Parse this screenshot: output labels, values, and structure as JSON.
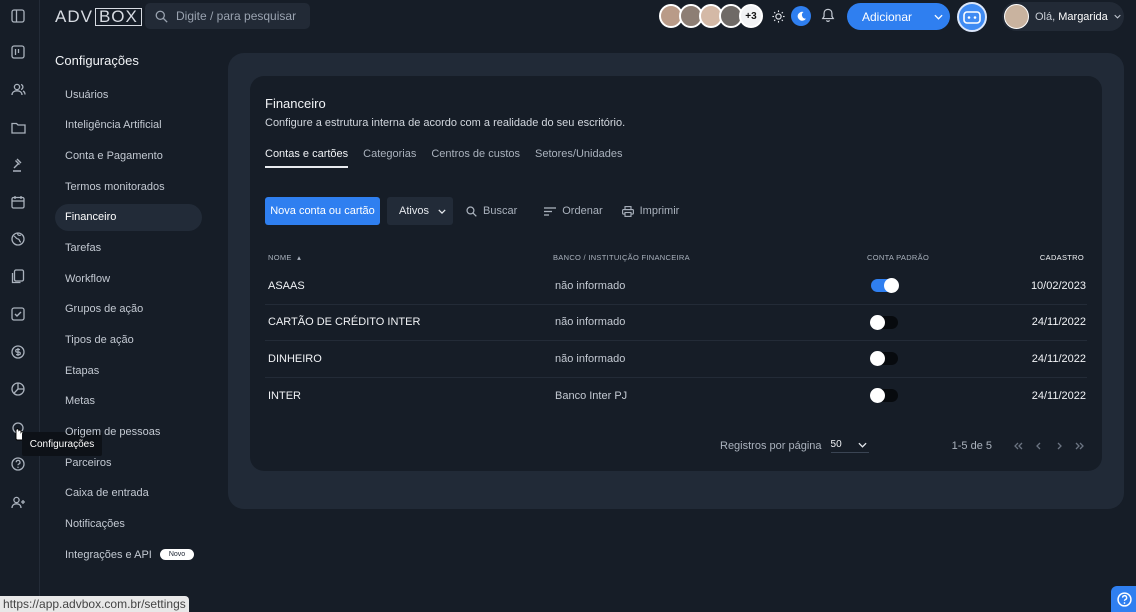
{
  "topbar": {
    "logo_adv": "ADV",
    "logo_box": "BOX",
    "search_placeholder": "Digite / para pesquisar",
    "avatars_more": "+3",
    "add_button": "Adicionar",
    "greeting": "Olá,",
    "user_name": "Margarida"
  },
  "rail": {
    "icons": [
      "layout-icon",
      "kanban-icon",
      "users-icon",
      "folder-icon",
      "gavel-icon",
      "calendar-icon",
      "globe-icon",
      "documents-icon",
      "checklist-icon",
      "dollar-icon",
      "chart-pie-icon",
      "gear-icon",
      "help-circle-icon",
      "user-plus-icon"
    ],
    "tooltip": "Configurações"
  },
  "sidebar": {
    "title": "Configurações",
    "items": [
      {
        "label": "Usuários"
      },
      {
        "label": "Inteligência Artificial"
      },
      {
        "label": "Conta e Pagamento"
      },
      {
        "label": "Termos monitorados"
      },
      {
        "label": "Financeiro",
        "active": true
      },
      {
        "label": "Tarefas"
      },
      {
        "label": "Workflow"
      },
      {
        "label": "Grupos de ação"
      },
      {
        "label": "Tipos de ação"
      },
      {
        "label": "Etapas"
      },
      {
        "label": "Metas"
      },
      {
        "label": "Origem de pessoas"
      },
      {
        "label": "Parceiros"
      },
      {
        "label": "Caixa de entrada"
      },
      {
        "label": "Notificações"
      },
      {
        "label": "Integrações e API",
        "badge": "Novo"
      }
    ]
  },
  "main": {
    "title": "Financeiro",
    "subtitle": "Configure a estrutura interna de acordo com a realidade do seu escritório.",
    "tabs": [
      {
        "label": "Contas e cartões",
        "active": true
      },
      {
        "label": "Categorias"
      },
      {
        "label": "Centros de custos"
      },
      {
        "label": "Setores/Unidades"
      }
    ],
    "toolbar": {
      "new_button": "Nova conta ou cartão",
      "filter_value": "Ativos",
      "search": "Buscar",
      "order": "Ordenar",
      "print": "Imprimir"
    },
    "table": {
      "columns": [
        "NOME",
        "BANCO / INSTITUIÇÃO FINANCEIRA",
        "CONTA PADRÃO",
        "CADASTRO"
      ],
      "rows": [
        {
          "name": "ASAAS",
          "bank": "não informado",
          "default": true,
          "date": "10/02/2023"
        },
        {
          "name": "CARTÃO DE CRÉDITO INTER",
          "bank": "não informado",
          "default": false,
          "date": "24/11/2022"
        },
        {
          "name": "DINHEIRO",
          "bank": "não informado",
          "default": false,
          "date": "24/11/2022"
        },
        {
          "name": "INTER",
          "bank": "Banco Inter PJ",
          "default": false,
          "date": "24/11/2022"
        }
      ]
    },
    "pagination": {
      "per_page_label": "Registros por página",
      "per_page_value": "50",
      "range": "1-5 de 5"
    }
  },
  "statusbar": {
    "url": "https://app.advbox.com.br/settings"
  },
  "colors": {
    "accent": "#2f7ff0",
    "background": "#161d27",
    "panel": "#212a37"
  }
}
